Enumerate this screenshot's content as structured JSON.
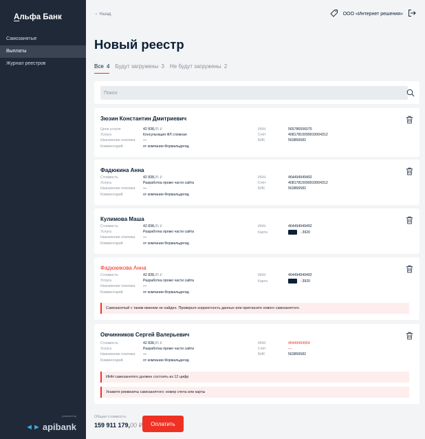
{
  "brand": {
    "logo_first": "А",
    "logo_rest": "льфа Банк",
    "powered": "powered by",
    "apibank": "apibank"
  },
  "nav": {
    "items": [
      {
        "label": "Самозанятые"
      },
      {
        "label": "Выплаты"
      },
      {
        "label": "Журнал реестров"
      }
    ]
  },
  "header": {
    "back": "Назад",
    "company": "ООО «Интернет решения»"
  },
  "page": {
    "title": "Новый реестр"
  },
  "tabs": [
    {
      "label": "Все",
      "count": "4"
    },
    {
      "label": "Будут загружены",
      "count": "3"
    },
    {
      "label": "Не будут загружены",
      "count": "2"
    }
  ],
  "search": {
    "placeholder": "Поиск"
  },
  "cards": [
    {
      "name": "Зюзин Константин Дмитриевич",
      "cost_label": "Цена услуги",
      "amount_main": "42 838,",
      "amount_kop": "85 ₽",
      "service_label": "Услуга",
      "service": "Консультация ФЛ сложная",
      "purpose_label": "Назначение платежа",
      "purpose": "—",
      "comment_label": "Комментарий",
      "comment": "от компании  Формальдегид",
      "inn_label": "ИНН",
      "inn": "565786556075",
      "acc_label": "Счёт",
      "acc": "40817810099910004312",
      "bik_label": "БИК",
      "bik": "563856582"
    },
    {
      "name": "Фадюкина Анна",
      "cost_label": "Стоимость",
      "amount_main": "42 838,",
      "amount_kop": "85 ₽",
      "service_label": "Услуга",
      "service": "Разработка промо части сайта",
      "purpose_label": "Назначение платежа",
      "purpose": "—",
      "comment_label": "Комментарий",
      "comment": "от компании  Формальдегид",
      "inn_label": "ИНН",
      "inn": "464494949492",
      "acc_label": "Счёт",
      "acc": "40817810099910004312",
      "bik_label": "БИК",
      "bik": "563856582"
    },
    {
      "name": "Кулимова Маша",
      "cost_label": "Стоимость",
      "amount_main": "42 838,",
      "amount_kop": "85 ₽",
      "service_label": "Услуга",
      "service": "Разработка промо части сайта",
      "purpose_label": "Назначение платежа",
      "purpose": "—",
      "comment_label": "Комментарий",
      "comment": "от компании  Формальдегид",
      "inn_label": "ИНН",
      "inn": "464494949492",
      "card_label": "Карта",
      "card": "··3920"
    },
    {
      "name": "Фадюкикова Анна",
      "cost_label": "Стоимость",
      "amount_main": "42 838,",
      "amount_kop": "85 ₽",
      "service_label": "Услуга",
      "service": "Разработка промо части сайта",
      "purpose_label": "Назначение платежа",
      "purpose": "—",
      "comment_label": "Комментарий",
      "comment": "от компании  Формальдегид",
      "inn_label": "ИНН",
      "inn": "464494949492",
      "card_label": "Карта",
      "card": "··3920",
      "error": "Самозанятый с таким именем не найден. Проверьте корректность данных или пригласите нового самозанятого."
    },
    {
      "name": "Овчинников Сергей Валерьевич",
      "cost_label": "Стоимость",
      "amount_main": "42 838,",
      "amount_kop": "85 ₽",
      "service_label": "Услуга",
      "service": "Разработка промо части сайта",
      "purpose_label": "Назначение платежа",
      "purpose": "—",
      "comment_label": "Комментарий",
      "comment": "от компании  Формальдегид",
      "inn_label": "ИНН",
      "inn": "46449494954",
      "acc_label": "Счёт",
      "acc": "—",
      "bik_label": "БИК",
      "bik": "563856582",
      "error1": "ИНН самозанятого должен состоять из 12 цифр",
      "error2": "Укажите реквизиты самозанятого: номер счета или карты"
    }
  ],
  "footer": {
    "total_label": "Общая стоимость:",
    "total_main": "159 911 179,",
    "total_kop": "00 ₽",
    "pay_button": "Оплатить"
  },
  "colors": {
    "accent": "#ef3124",
    "sidebar": "#1f2937",
    "background": "#f3f4f5",
    "text": "#0b1f35"
  }
}
